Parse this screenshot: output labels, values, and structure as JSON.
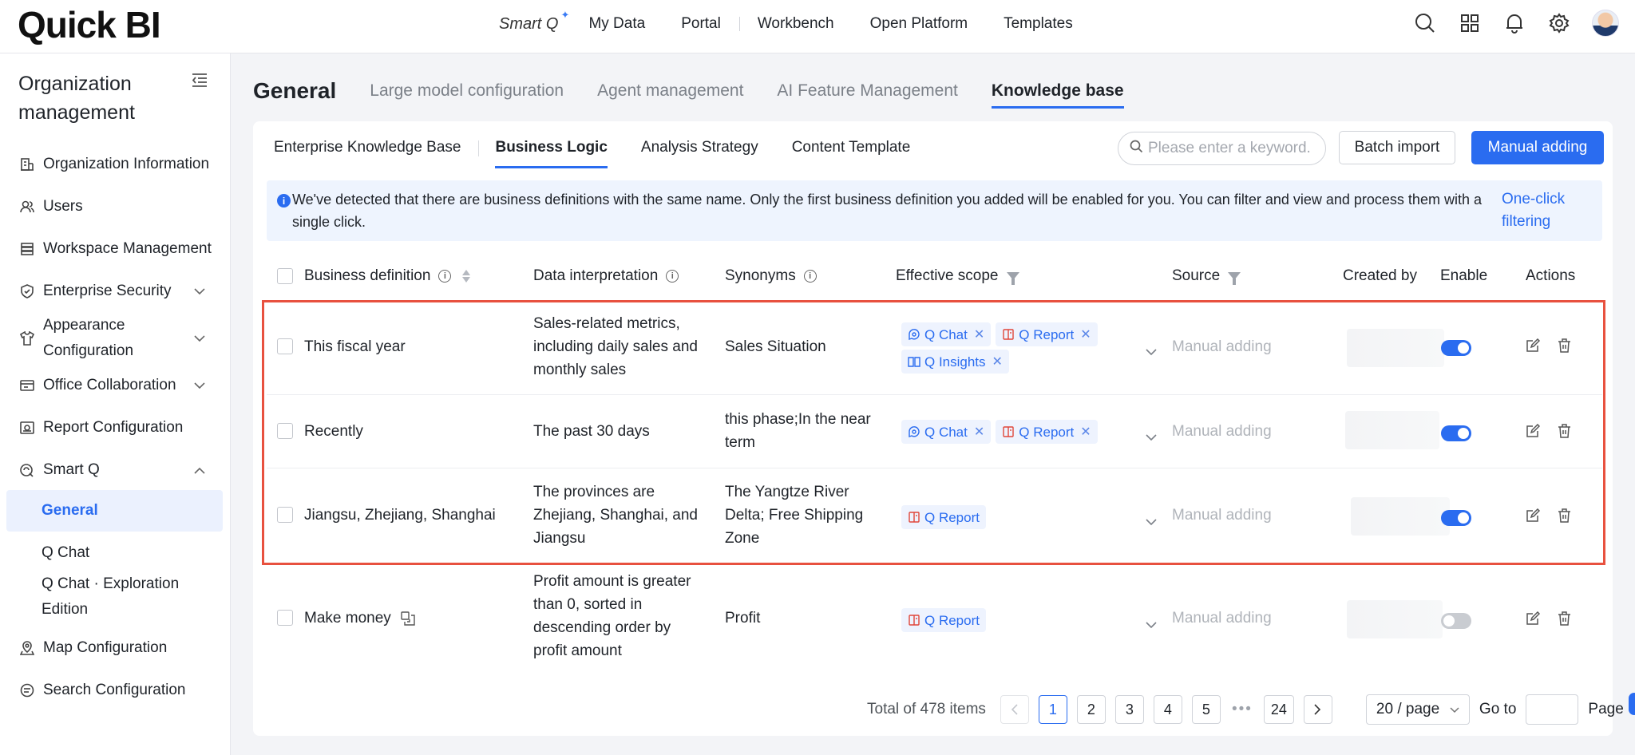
{
  "app": {
    "logo": "Quick BI"
  },
  "topnav": {
    "smartq": "Smart Q",
    "items": [
      "My Data",
      "Portal",
      "Workbench",
      "Open Platform",
      "Templates"
    ]
  },
  "sidebar": {
    "title": "Organization management",
    "items": [
      {
        "label": "Organization Information",
        "icon": "building-icon"
      },
      {
        "label": "Users",
        "icon": "users-icon"
      },
      {
        "label": "Workspace Management",
        "icon": "workspace-icon"
      },
      {
        "label": "Enterprise Security",
        "icon": "shield-icon"
      },
      {
        "label": "Appearance Configuration",
        "icon": "shirt-icon"
      },
      {
        "label": "Office Collaboration",
        "icon": "collab-icon"
      },
      {
        "label": "Report Configuration",
        "icon": "report-icon"
      },
      {
        "label": "Smart Q",
        "icon": "smartq-icon"
      },
      {
        "label": "General"
      },
      {
        "label": "Q Chat"
      },
      {
        "label": "Q Chat · Exploration Edition"
      },
      {
        "label": "Map Configuration",
        "icon": "map-icon"
      },
      {
        "label": "Search Configuration",
        "icon": "search-config-icon"
      }
    ]
  },
  "page": {
    "title": "General",
    "tabs": [
      "Large model configuration",
      "Agent management",
      "AI Feature Management",
      "Knowledge base"
    ],
    "active_tab": "Knowledge base"
  },
  "subtabs": [
    "Enterprise Knowledge Base",
    "Business Logic",
    "Analysis Strategy",
    "Content Template"
  ],
  "search": {
    "placeholder": "Please enter a keyword."
  },
  "buttons": {
    "batch": "Batch import",
    "manual": "Manual adding"
  },
  "notice": {
    "text": "We've detected that there are business definitions with the same name. Only the first business definition you added will be enabled for you. You can filter and view and process them with a single click.",
    "link": "One-click filtering"
  },
  "table": {
    "columns": [
      "Business definition",
      "Data interpretation",
      "Synonyms",
      "Effective scope",
      "Source",
      "Created by",
      "Enable",
      "Actions"
    ],
    "rows": [
      {
        "definition": "This fiscal year",
        "interpretation": "Sales-related metrics, including daily sales and monthly sales",
        "synonyms": "Sales Situation",
        "scopes": [
          "Q Chat",
          "Q Report",
          "Q Insights"
        ],
        "source": "Manual adding",
        "enabled": true
      },
      {
        "definition": "Recently",
        "interpretation": "The past 30 days",
        "synonyms": "this phase;In the near term",
        "scopes": [
          "Q Chat",
          "Q Report"
        ],
        "source": "Manual adding",
        "enabled": true
      },
      {
        "definition": "Jiangsu, Zhejiang, Shanghai",
        "interpretation": "The provinces are Zhejiang, Shanghai, and Jiangsu",
        "synonyms": "The Yangtze River Delta; Free Shipping Zone",
        "scopes": [
          "Q Report"
        ],
        "source": "Manual adding",
        "enabled": true
      },
      {
        "definition": "Make money",
        "interpretation": "Profit amount is greater than 0, sorted in descending order by profit amount",
        "synonyms": "Profit",
        "scopes": [
          "Q Report"
        ],
        "source": "Manual adding",
        "enabled": false
      }
    ]
  },
  "pagination": {
    "total": "Total of 478 items",
    "pages": [
      "1",
      "2",
      "3",
      "4",
      "5",
      "24"
    ],
    "current": "1",
    "ellipsis": "•••",
    "page_size": "20 / page",
    "goto_label": "Go to",
    "page_label": "Page"
  }
}
